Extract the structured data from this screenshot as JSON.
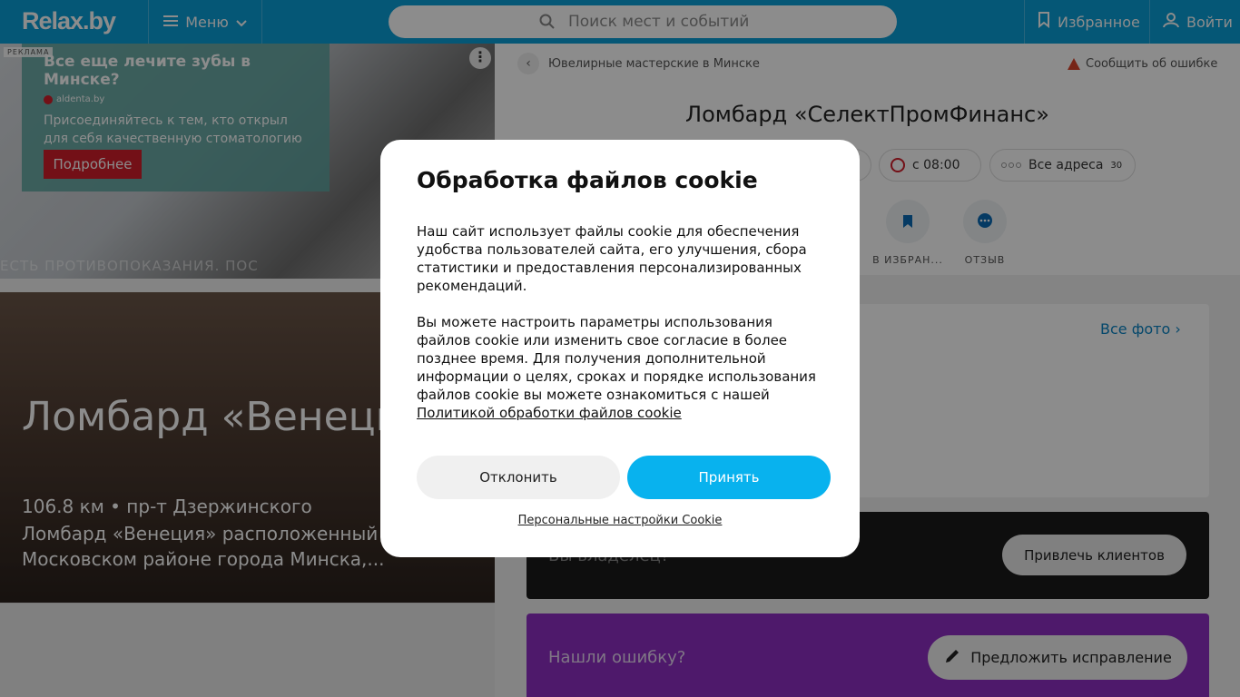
{
  "header": {
    "logo": "Relax.by",
    "menu_label": "Меню",
    "search_placeholder": "Поиск мест и событий",
    "favorites_label": "Избранное",
    "login_label": "Войти",
    "brand_color": "#0a9fd8"
  },
  "ad": {
    "label": "РЕКЛАМА",
    "title": "Все еще лечите зубы в Минске?",
    "source": "aldenta.by",
    "description": "Присоединяйтесь к тем, кто открыл для себя качественную стоматологию",
    "button": "Подробнее",
    "footer": "ЕСТЬ ПРОТИВОПОКАЗАНИЯ. ПОС"
  },
  "card": {
    "title": "Ломбард «Венеция»",
    "subtitle": "106.8 км • пр-т Дзержинского",
    "description": "Ломбард «Венеция» расположенный в Московском районе города Минска,..."
  },
  "place": {
    "breadcrumb": "Ювелирные мастерские в Минске",
    "report": "Сообщить об ошибке",
    "title": "Ломбард «СелектПромФинанс»",
    "hours": "с 08:00",
    "all_addresses": "Все адреса",
    "addresses_count": "30",
    "action_favorite": "В ИЗБРАН...",
    "action_review": "ОТЗЫВ",
    "all_photos": "Все фото",
    "owner_text": "Вы владелец?",
    "owner_button": "Привлечь клиентов",
    "error_text": "Нашли ошибку?",
    "error_button": "Предложить исправление"
  },
  "cookie": {
    "title": "Обработка файлов cookie",
    "paragraph1": "Наш сайт использует файлы cookie для обеспечения удобства пользователей сайта, его улучшения, сбора статистики и предоставления персонализированных рекомендаций.",
    "paragraph2": "Вы можете настроить параметры использования файлов cookie или изменить свое согласие в более позднее время. Для получения дополнительной информации о целях, сроках и порядке использования файлов cookie вы можете ознакомиться с нашей",
    "policy_link": "Политикой обработки файлов cookie",
    "decline": "Отклонить",
    "accept": "Принять",
    "settings": "Персональные настройки Cookie",
    "accept_color": "#08b2ee"
  }
}
